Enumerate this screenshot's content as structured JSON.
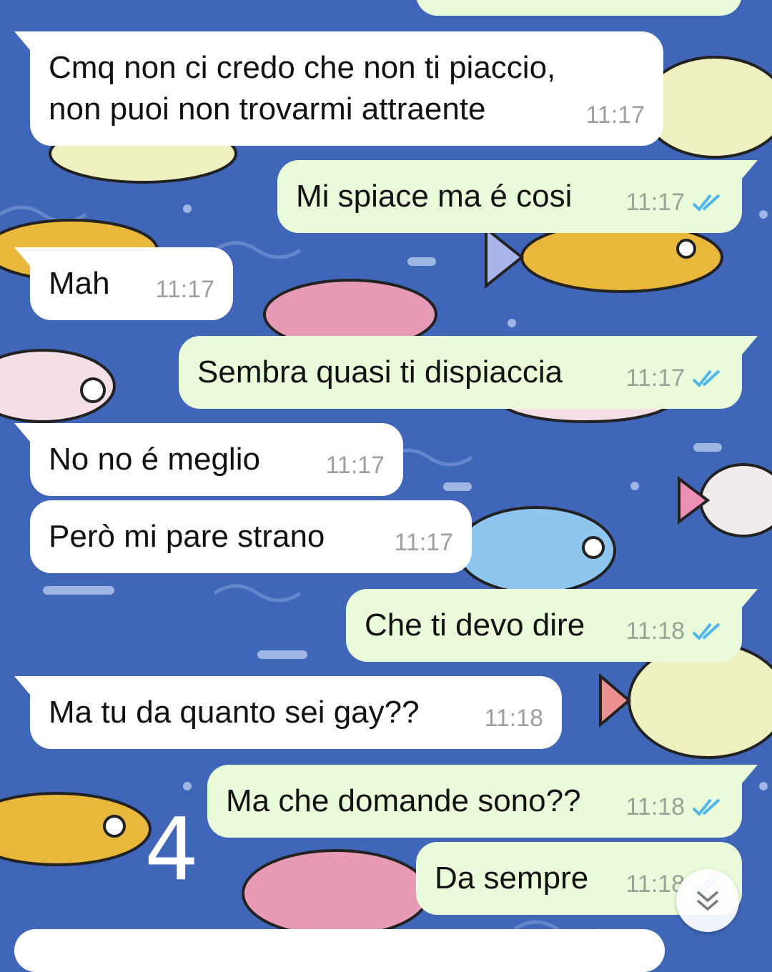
{
  "messages": [
    {
      "direction": "incoming",
      "text": "Cmq non ci credo che non ti piaccio,\nnon puoi non trovarmi attraente",
      "time": "11:17"
    },
    {
      "direction": "outgoing",
      "text": "Mi spiace ma é cosi",
      "time": "11:17",
      "status": "read"
    },
    {
      "direction": "incoming",
      "text": "Mah",
      "time": "11:17"
    },
    {
      "direction": "outgoing",
      "text": "Sembra quasi ti dispiaccia",
      "time": "11:17",
      "status": "read"
    },
    {
      "direction": "incoming",
      "text": "No no é meglio",
      "time": "11:17"
    },
    {
      "direction": "incoming",
      "text": "Però mi pare strano",
      "time": "11:17"
    },
    {
      "direction": "outgoing",
      "text": "Che ti devo dire",
      "time": "11:18",
      "status": "read"
    },
    {
      "direction": "incoming",
      "text": "Ma tu da quanto sei gay??",
      "time": "11:18"
    },
    {
      "direction": "outgoing",
      "text": "Ma che domande sono??",
      "time": "11:18",
      "status": "read"
    },
    {
      "direction": "outgoing",
      "text": "Da sempre",
      "time": "11:18",
      "status": "read"
    }
  ],
  "overlay_mark": "4",
  "scroll_down_icon": "chevron-double-down-icon",
  "colors": {
    "wallpaper": "#3f66b8",
    "incoming_bubble": "#ffffff",
    "outgoing_bubble": "#e9fbd9",
    "read_ticks": "#4fb6ec",
    "timestamp": "#9aa29a"
  }
}
